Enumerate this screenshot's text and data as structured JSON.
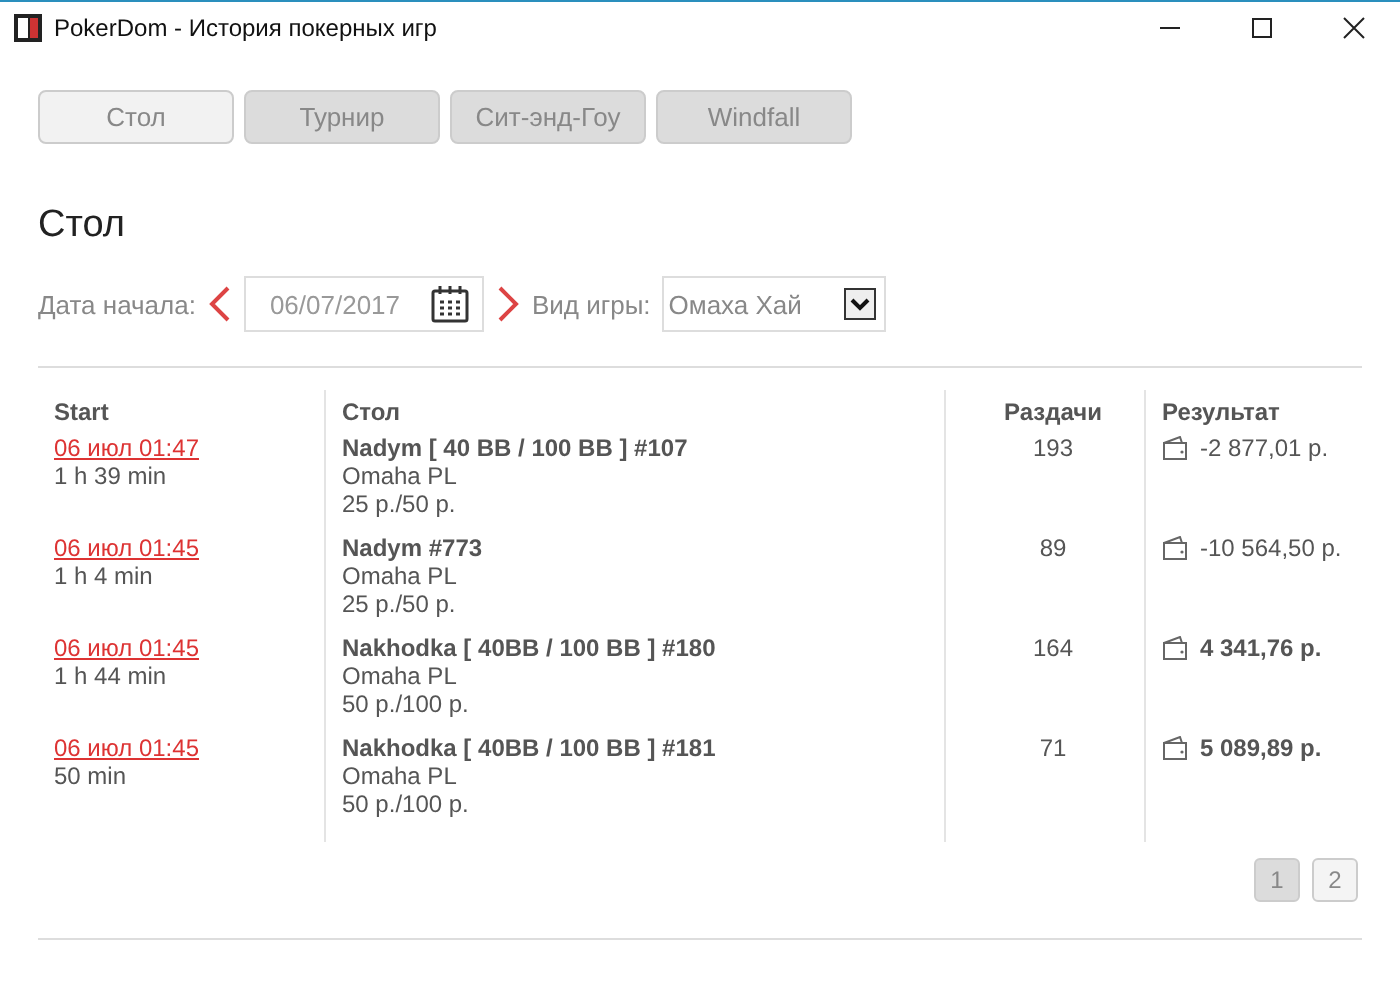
{
  "window": {
    "title": "PokerDom - История покерных игр"
  },
  "tabs": [
    {
      "label": "Стол",
      "selected": true
    },
    {
      "label": "Турнир",
      "selected": false
    },
    {
      "label": "Сит-энд-Гоу",
      "selected": false
    },
    {
      "label": "Windfall",
      "selected": false
    }
  ],
  "heading": "Стол",
  "filters": {
    "date_label": "Дата начала:",
    "date": "06/07/2017",
    "game_label": "Вид игры:",
    "game": "Омаха Хай"
  },
  "table": {
    "columns": [
      "Start",
      "Стол",
      "Раздачи",
      "Результат"
    ],
    "rows": [
      {
        "start": "06 июл 01:47",
        "duration": "1 h 39 min",
        "table": "Nadym [ 40 BB / 100 BB ] #107",
        "game": "Omaha PL",
        "stakes": "25 р./50 р.",
        "hands": "193",
        "result": "-2 877,01 р.",
        "positive": false
      },
      {
        "start": "06 июл 01:45",
        "duration": "1 h 4 min",
        "table": "Nadym #773",
        "game": "Omaha PL",
        "stakes": "25 р./50 р.",
        "hands": "89",
        "result": "-10 564,50 р.",
        "positive": false
      },
      {
        "start": "06 июл 01:45",
        "duration": "1 h 44 min",
        "table": "Nakhodka [ 40BB / 100 BB ] #180",
        "game": "Omaha PL",
        "stakes": "50 р./100 р.",
        "hands": "164",
        "result": "4 341,76 р.",
        "positive": true
      },
      {
        "start": "06 июл 01:45",
        "duration": "50 min",
        "table": "Nakhodka [ 40BB / 100 BB ] #181",
        "game": "Omaha PL",
        "stakes": "50 р./100 р.",
        "hands": "71",
        "result": "5 089,89 р.",
        "positive": true
      }
    ]
  },
  "pages": [
    {
      "label": "1",
      "selected": true
    },
    {
      "label": "2",
      "selected": false
    }
  ]
}
